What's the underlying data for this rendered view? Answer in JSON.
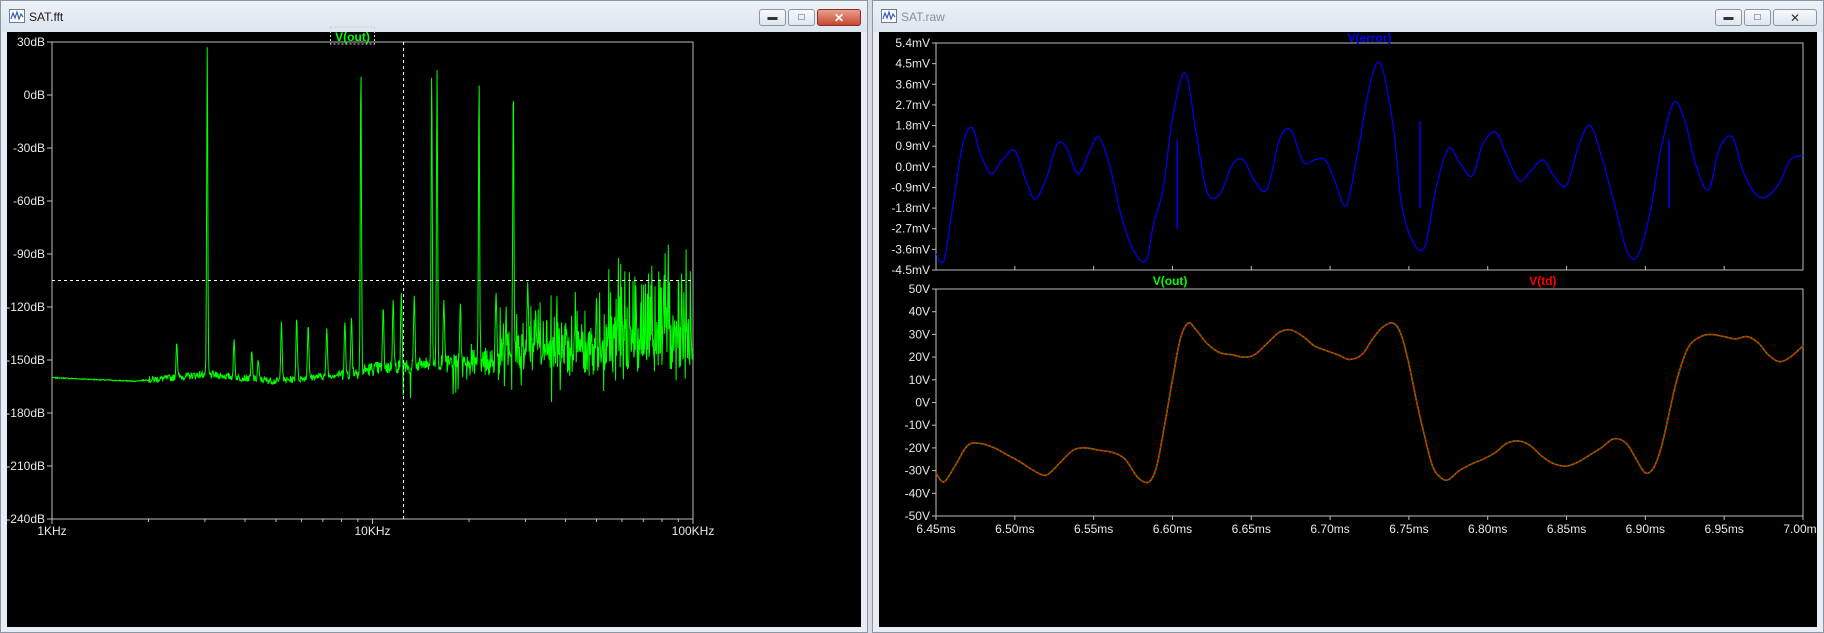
{
  "left_window": {
    "title": "SAT.fft",
    "trace_label": "V(out)",
    "trace_color": "#00ff00",
    "chart_data": {
      "type": "line",
      "title": "",
      "xscale": "log",
      "xlim": [
        1000,
        100000
      ],
      "ylim": [
        -240,
        30
      ],
      "x_ticks": [
        "1KHz",
        "10KHz",
        "100KHz"
      ],
      "y_ticks": [
        "30dB",
        "0dB",
        "-30dB",
        "-60dB",
        "-90dB",
        "-120dB",
        "-150dB",
        "-180dB",
        "-210dB",
        "-240dB"
      ],
      "cursor": {
        "x": 12500,
        "y": -105
      },
      "series": [
        {
          "name": "V(out)",
          "noise_floor": [
            [
              1000,
              -160
            ],
            [
              1800,
              -162
            ],
            [
              2400,
              -160
            ],
            [
              3000,
              -158
            ],
            [
              5000,
              -162
            ],
            [
              8000,
              -158
            ],
            [
              10000,
              -155
            ],
            [
              20000,
              -150
            ],
            [
              50000,
              -145
            ],
            [
              100000,
              -140
            ]
          ],
          "peaks": [
            {
              "f": 3050,
              "db": 27
            },
            {
              "f": 2450,
              "db": -140
            },
            {
              "f": 3700,
              "db": -138
            },
            {
              "f": 4200,
              "db": -145
            },
            {
              "f": 4400,
              "db": -150
            },
            {
              "f": 5200,
              "db": -128
            },
            {
              "f": 5800,
              "db": -126
            },
            {
              "f": 6300,
              "db": -130
            },
            {
              "f": 7200,
              "db": -132
            },
            {
              "f": 8200,
              "db": -128
            },
            {
              "f": 8600,
              "db": -126
            },
            {
              "f": 9200,
              "db": 17
            },
            {
              "f": 10800,
              "db": -120
            },
            {
              "f": 11600,
              "db": -116
            },
            {
              "f": 12300,
              "db": -112
            },
            {
              "f": 13500,
              "db": -113
            },
            {
              "f": 15300,
              "db": 14
            },
            {
              "f": 15900,
              "db": 14
            },
            {
              "f": 16700,
              "db": -116
            },
            {
              "f": 18800,
              "db": -118
            },
            {
              "f": 21500,
              "db": 10
            },
            {
              "f": 24300,
              "db": -112
            },
            {
              "f": 27500,
              "db": 8
            },
            {
              "f": 30500,
              "db": -106
            }
          ]
        }
      ]
    }
  },
  "right_window": {
    "title": "SAT.raw",
    "top_pane": {
      "trace_label": "V(error)",
      "trace_color": "#0000ff",
      "chart_data": {
        "type": "line",
        "title": "",
        "xlim": [
          6.45,
          7.0
        ],
        "ylim": [
          -4.5,
          5.4
        ],
        "y_ticks": [
          "5.4mV",
          "4.5mV",
          "3.6mV",
          "2.7mV",
          "1.8mV",
          "0.9mV",
          "0.0mV",
          "-0.9mV",
          "-1.8mV",
          "-2.7mV",
          "-3.6mV",
          "-4.5mV"
        ],
        "series": [
          {
            "name": "V(error)",
            "x": [
              6.45,
              6.455,
              6.46,
              6.467,
              6.473,
              6.478,
              6.485,
              6.492,
              6.5,
              6.507,
              6.513,
              6.52,
              6.527,
              6.533,
              6.54,
              6.547,
              6.553,
              6.56,
              6.567,
              6.575,
              6.583,
              6.588,
              6.594,
              6.6,
              6.608,
              6.615,
              6.622,
              6.63,
              6.638,
              6.645,
              6.652,
              6.66,
              6.668,
              6.675,
              6.683,
              6.69,
              6.697,
              6.703,
              6.71,
              6.717,
              6.725,
              6.732,
              6.74,
              6.745,
              6.752,
              6.76,
              6.767,
              6.775,
              6.782,
              6.79,
              6.797,
              6.805,
              6.812,
              6.82,
              6.827,
              6.835,
              6.842,
              6.85,
              6.858,
              6.865,
              6.872,
              6.88,
              6.888,
              6.895,
              6.903,
              6.91,
              6.918,
              6.925,
              6.932,
              6.94,
              6.947,
              6.955,
              6.962,
              6.97,
              6.977,
              6.985,
              6.992,
              7.0
            ],
            "y": [
              -3.8,
              -4.1,
              -2.0,
              1.0,
              1.7,
              0.6,
              -0.3,
              0.3,
              0.7,
              -0.6,
              -1.4,
              -0.5,
              1.0,
              0.8,
              -0.3,
              0.6,
              1.3,
              0.1,
              -2.0,
              -3.6,
              -4.1,
              -2.5,
              -1.0,
              2.1,
              4.1,
              1.5,
              -1.1,
              -1.2,
              0.1,
              0.3,
              -0.6,
              -1.0,
              1.2,
              1.6,
              0.2,
              0.3,
              0.3,
              -0.6,
              -1.7,
              0.4,
              3.5,
              4.5,
              1.8,
              -1.5,
              -3.2,
              -3.5,
              -1.0,
              0.8,
              0.2,
              -0.4,
              1.0,
              1.5,
              0.5,
              -0.6,
              -0.2,
              0.3,
              -0.4,
              -0.8,
              1.0,
              1.8,
              0.5,
              -1.5,
              -3.6,
              -3.9,
              -2.0,
              0.8,
              2.8,
              2.0,
              0.1,
              -1.0,
              0.8,
              1.3,
              -0.2,
              -1.2,
              -1.3,
              -0.7,
              0.3,
              0.5
            ]
          }
        ]
      }
    },
    "bottom_pane": {
      "trace_labels": [
        {
          "label": "V(out)",
          "color": "#00ff00"
        },
        {
          "label": "V(td)",
          "color": "#ff0000"
        }
      ],
      "chart_data": {
        "type": "line",
        "title": "",
        "xlim": [
          6.45,
          7.0
        ],
        "ylim": [
          -50,
          50
        ],
        "x_ticks": [
          "6.45ms",
          "6.50ms",
          "6.55ms",
          "6.60ms",
          "6.65ms",
          "6.70ms",
          "6.75ms",
          "6.80ms",
          "6.85ms",
          "6.90ms",
          "6.95ms",
          "7.00ms"
        ],
        "y_ticks": [
          "50V",
          "40V",
          "30V",
          "20V",
          "10V",
          "0V",
          "-10V",
          "-20V",
          "-30V",
          "-40V",
          "-50V"
        ],
        "series": [
          {
            "name": "V(td)",
            "x": [
              6.45,
              6.455,
              6.462,
              6.47,
              6.478,
              6.487,
              6.495,
              6.503,
              6.512,
              6.52,
              6.528,
              6.537,
              6.545,
              6.553,
              6.562,
              6.57,
              6.578,
              6.585,
              6.59,
              6.595,
              6.6,
              6.605,
              6.61,
              6.615,
              6.622,
              6.63,
              6.638,
              6.645,
              6.652,
              6.66,
              6.668,
              6.675,
              6.683,
              6.69,
              6.697,
              6.705,
              6.712,
              6.72,
              6.727,
              6.733,
              6.74,
              6.745,
              6.75,
              6.755,
              6.76,
              6.765,
              6.77,
              6.775,
              6.782,
              6.79,
              6.797,
              6.805,
              6.812,
              6.82,
              6.827,
              6.835,
              6.842,
              6.85,
              6.858,
              6.865,
              6.872,
              6.88,
              6.888,
              6.895,
              6.9,
              6.905,
              6.91,
              6.915,
              6.92,
              6.927,
              6.935,
              6.942,
              6.95,
              6.957,
              6.965,
              6.972,
              6.978,
              6.985,
              6.992,
              7.0
            ],
            "y": [
              -31,
              -35,
              -28,
              -19,
              -18,
              -20,
              -23,
              -26,
              -30,
              -32,
              -27,
              -21,
              -20,
              -21,
              -22,
              -25,
              -33,
              -35,
              -28,
              -10,
              10,
              28,
              35,
              32,
              26,
              22,
              21,
              20,
              21,
              26,
              31,
              32,
              29,
              25,
              23,
              21,
              19,
              21,
              28,
              33,
              35,
              30,
              17,
              0,
              -15,
              -28,
              -33,
              -34,
              -30,
              -27,
              -25,
              -22,
              -18,
              -17,
              -19,
              -24,
              -27,
              -28,
              -26,
              -23,
              -20,
              -16,
              -18,
              -26,
              -31,
              -29,
              -20,
              -5,
              10,
              24,
              29,
              30,
              29,
              28,
              29,
              26,
              21,
              18,
              20,
              25
            ]
          }
        ]
      }
    }
  }
}
